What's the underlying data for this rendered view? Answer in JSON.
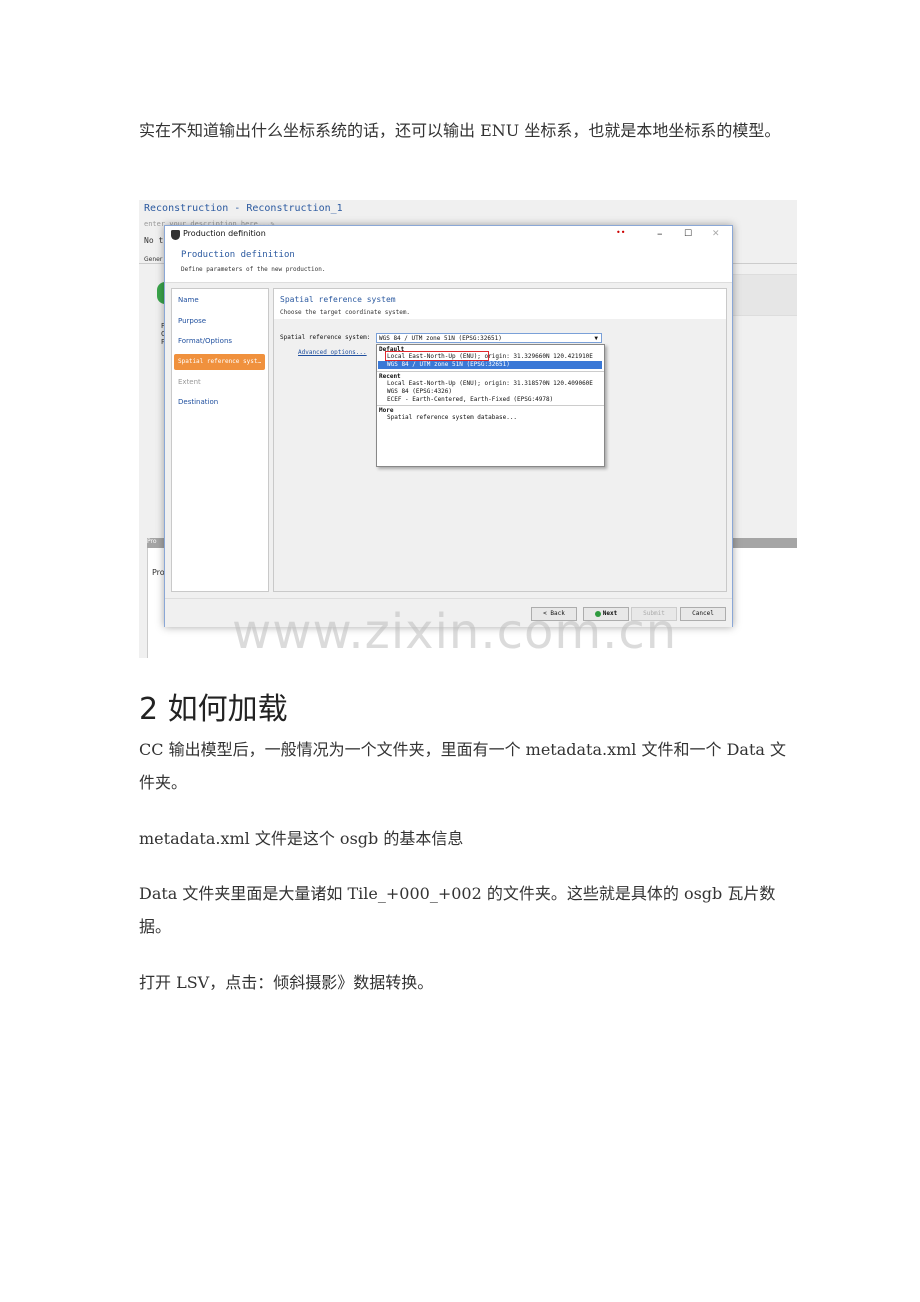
{
  "intro_text": "实在不知道输出什么坐标系统的话，还可以输出 ENU 坐标系，也就是本地坐标系的模型。",
  "screenshot": {
    "bg_title": "Reconstruction - Reconstruction_1",
    "bg_sub": "enter your description here...✎",
    "bg_not": "No t",
    "bg_gen": "Gener",
    "bg_pro": "Pro",
    "bg_pro2": "Pro",
    "bg_side": "F\nC\nP",
    "dialog": {
      "title": "Production definition",
      "dots": "••",
      "minimize": "–",
      "maximize": "☐",
      "close": "✕",
      "heading": "Production definition",
      "subheading": "Define parameters of the new production.",
      "steps": [
        "Name",
        "Purpose",
        "Format/Options",
        "Spatial reference syst…",
        "Extent",
        "Destination"
      ],
      "content_title": "Spatial reference system",
      "content_sub": "Choose the target coordinate system.",
      "srs_label": "Spatial reference system:",
      "advanced_link": "Advanced options...",
      "selected_value": "WGS 84 / UTM zone 51N (EPSG:32651)",
      "dropdown": {
        "default_label": "Default",
        "default_items": [
          "Local East-North-Up (ENU); origin: 31.329660N 120.421910E",
          "WGS 84 / UTM zone 51N (EPSG:32651)"
        ],
        "recent_label": "Recent",
        "recent_items": [
          "Local East-North-Up (ENU); origin: 31.318570N 120.409060E",
          "WGS 84 (EPSG:4326)",
          "ECEF - Earth-Centered, Earth-Fixed (EPSG:4978)"
        ],
        "more_label": "More",
        "more_items": [
          "Spatial reference system database..."
        ]
      },
      "buttons": {
        "back": "< Back",
        "next": "Next",
        "submit": "Submit",
        "cancel": "Cancel"
      }
    }
  },
  "watermark": "www.zixin.com.cn",
  "section_heading": "2 如何加载",
  "para1": "CC 输出模型后，一般情况为一个文件夹，里面有一个 metadata.xml 文件和一个 Data 文件夹。",
  "para2": "metadata.xml 文件是这个 osgb 的基本信息",
  "para3": "Data 文件夹里面是大量诸如 Tile_+000_+002 的文件夹。这些就是具体的 osgb 瓦片数据。",
  "para4": "打开 LSV，点击：倾斜摄影》数据转换。",
  "colors": {
    "accent_orange": "#f0913d",
    "title_blue": "#2c5aa0",
    "highlight_red": "#e0282d",
    "selection_blue": "#3a78d6"
  }
}
